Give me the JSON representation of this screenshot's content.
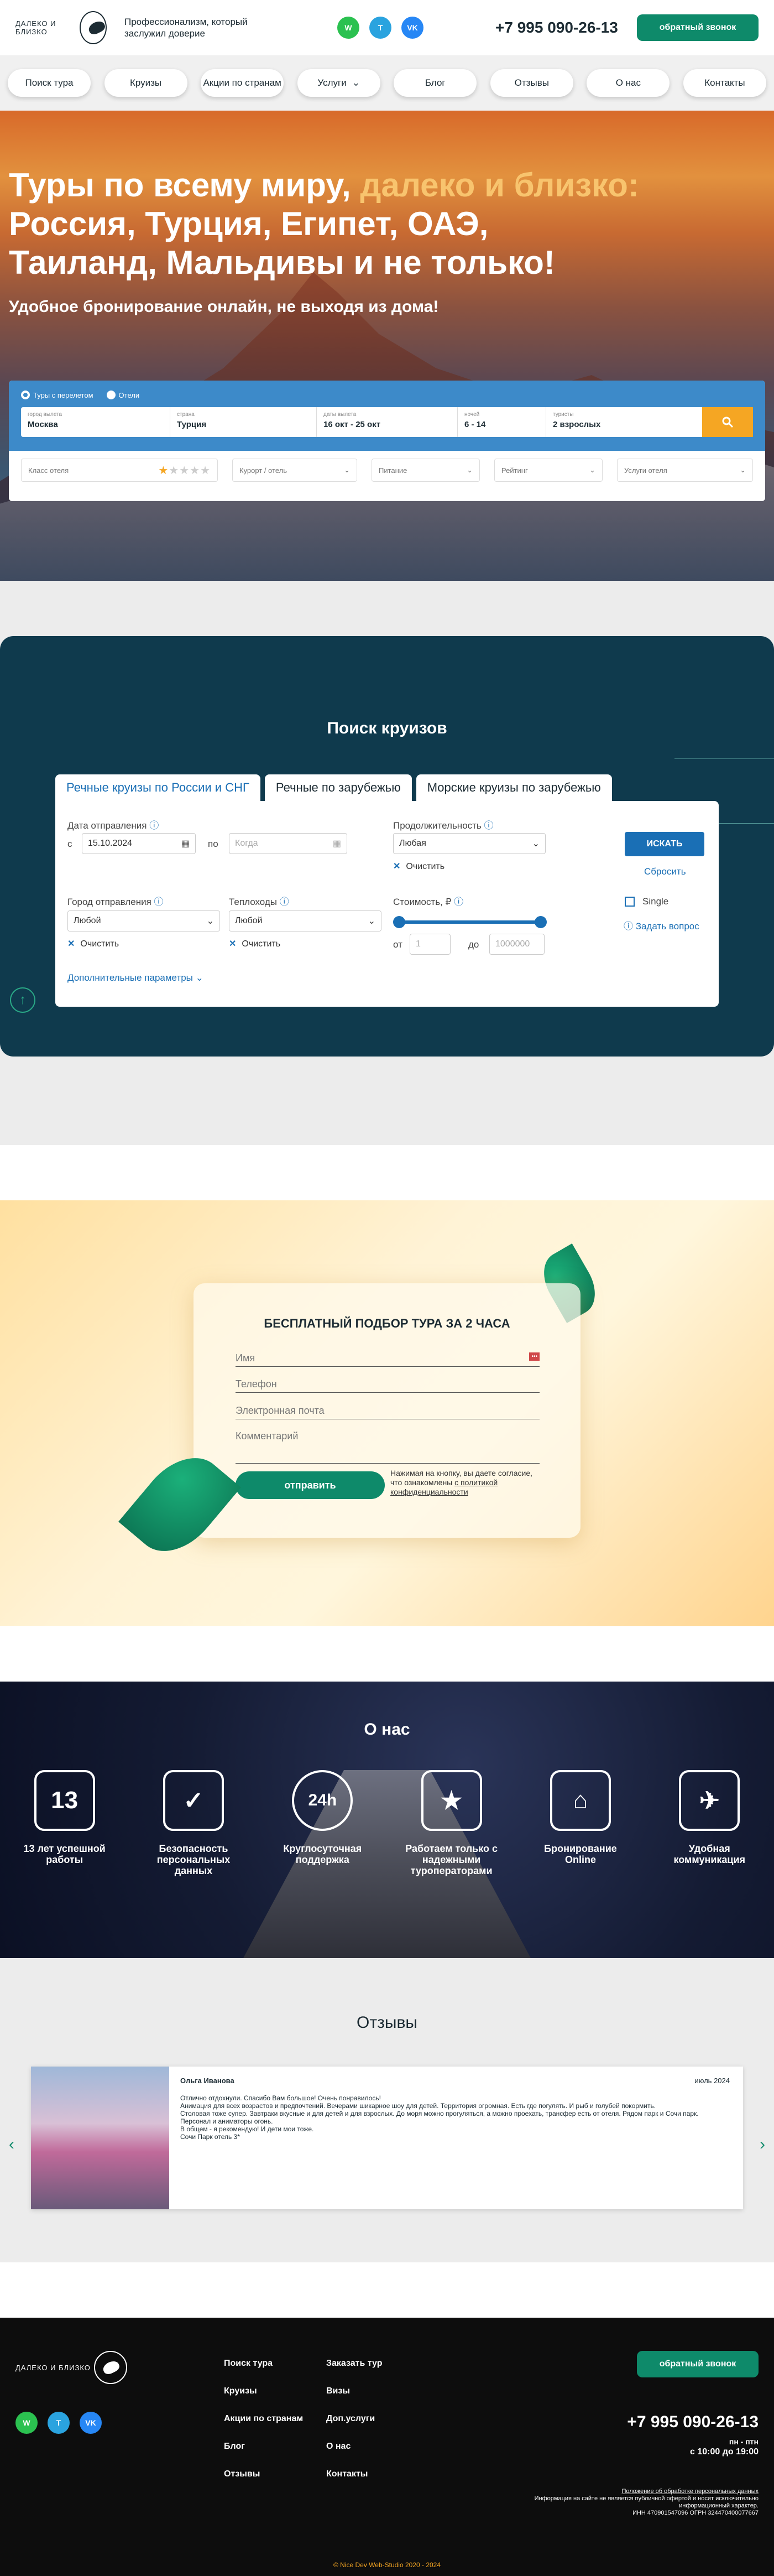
{
  "header": {
    "logo": "ДАЛЕКО И БЛИЗКО",
    "slogan": "Профессионализм, который заслужил доверие",
    "socials": [
      {
        "name": "whatsapp",
        "glyph": "W"
      },
      {
        "name": "telegram",
        "glyph": "T"
      },
      {
        "name": "vk",
        "glyph": "VK"
      }
    ],
    "phone": "+7 995 090-26-13",
    "callback": "обратный звонок"
  },
  "nav": [
    "Поиск тура",
    "Круизы",
    "Акции по странам",
    "Услуги",
    "Блог",
    "Отзывы",
    "О нас",
    "Контакты"
  ],
  "hero": {
    "title_a": "Туры по всему миру, ",
    "title_hl": "далеко и близко:",
    "title_b": "Россия, Турция, Египет, ОАЭ, Таиланд, Мальдивы и не только!",
    "subtitle": "Удобное бронирование онлайн, не выходя из дома!"
  },
  "search": {
    "radio1": "Туры с перелетом",
    "radio2": "Отели",
    "fields": [
      {
        "label": "город вылета",
        "value": "Москва"
      },
      {
        "label": "страна",
        "value": "Турция"
      },
      {
        "label": "даты вылета",
        "value": "16 окт - 25 окт"
      },
      {
        "label": "ночей",
        "value": "6 - 14"
      },
      {
        "label": "туристы",
        "value": "2 взрослых"
      }
    ],
    "filters": [
      "Класс отеля",
      "Курорт / отель",
      "Питание",
      "Рейтинг",
      "Услуги отеля"
    ],
    "stars_on": 1,
    "stars_total": 5
  },
  "cruise": {
    "title": "Поиск круизов",
    "tabs": [
      "Речные круизы по России и СНГ",
      "Речные по зарубежью",
      "Морские круизы по зарубежью"
    ],
    "date_label": "Дата отправления",
    "from": "с",
    "date_value": "15.10.2024",
    "to": "по",
    "to_placeholder": "Когда",
    "duration_label": "Продолжительность",
    "duration_value": "Любая",
    "clear": "Очистить",
    "city_label": "Город отправления",
    "city_value": "Любой",
    "ship_label": "Теплоходы",
    "ship_value": "Любой",
    "price_label": "Стоимость, ₽",
    "price_from": "от",
    "price_min": "1",
    "price_to": "до",
    "price_max": "1000000",
    "search": "ИСКАТЬ",
    "reset": "Сбросить",
    "single": "Single",
    "ask": "Задать вопрос",
    "more": "Дополнительные параметры"
  },
  "pick": {
    "title": "БЕСПЛАТНЫЙ ПОДБОР ТУРА ЗА 2 ЧАСА",
    "name": "Имя",
    "phone": "Телефон",
    "email": "Электронная почта",
    "comment": "Комментарий",
    "submit": "отправить",
    "note": "Нажимая на кнопку, вы даете согласие, что ознакомлены",
    "note_link": "с политикой конфиденциальности"
  },
  "about": {
    "title": "О нас",
    "features": [
      {
        "icon": "13",
        "label": "13 лет успешной работы"
      },
      {
        "icon": "✓",
        "label": "Безопасность персональных данных"
      },
      {
        "icon": "24h",
        "label": "Круглосуточная поддержка"
      },
      {
        "icon": "★",
        "label": "Работаем только с надежными туроператорами"
      },
      {
        "icon": "⌂",
        "label": "Бронирование Online"
      },
      {
        "icon": "✈",
        "label": "Удобная коммуникация"
      }
    ]
  },
  "reviews": {
    "title": "Отзывы",
    "name": "Ольга Иванова",
    "date": "июль 2024",
    "text": "Отлично отдохнули. Спасибо Вам большое! Очень понравилось!\nАнимация для всех возрастов и предпочтений. Вечерами шикарное шоу для детей. Территория огромная. Есть где погулять. И рыб и голубей покормить.\nСтоловая тоже супер. Завтраки вкусные и для детей и для взрослых. До моря можно прогуляться, а можно проехать, трансфер есть от отеля. Рядом парк и Сочи парк.\nПерсонал и аниматоры огонь.\nВ общем - я рекомендую! И дети мои тоже.\nСочи Парк отель 3*"
  },
  "footer": {
    "logo": "ДАЛЕКО И БЛИЗКО",
    "col1": [
      "Поиск тура",
      "Круизы",
      "Акции по странам",
      "Блог",
      "Отзывы"
    ],
    "col2": [
      "Заказать тур",
      "Визы",
      "Доп.услуги",
      "О нас",
      "Контакты"
    ],
    "callback": "обратный звонок",
    "phone": "+7 995 090-26-13",
    "days": "пн - птн",
    "hours": "с 10:00 до 19:00",
    "policy": "Положение об обработке персональных данных",
    "legal": "Информация на сайте не является публичной офертой и носит исключительно информационный характер.",
    "inn": "ИНН 470901547096 ОГРН 324470400077667",
    "copy": "© Nice Dev Web-Studio 2020 - 2024"
  }
}
